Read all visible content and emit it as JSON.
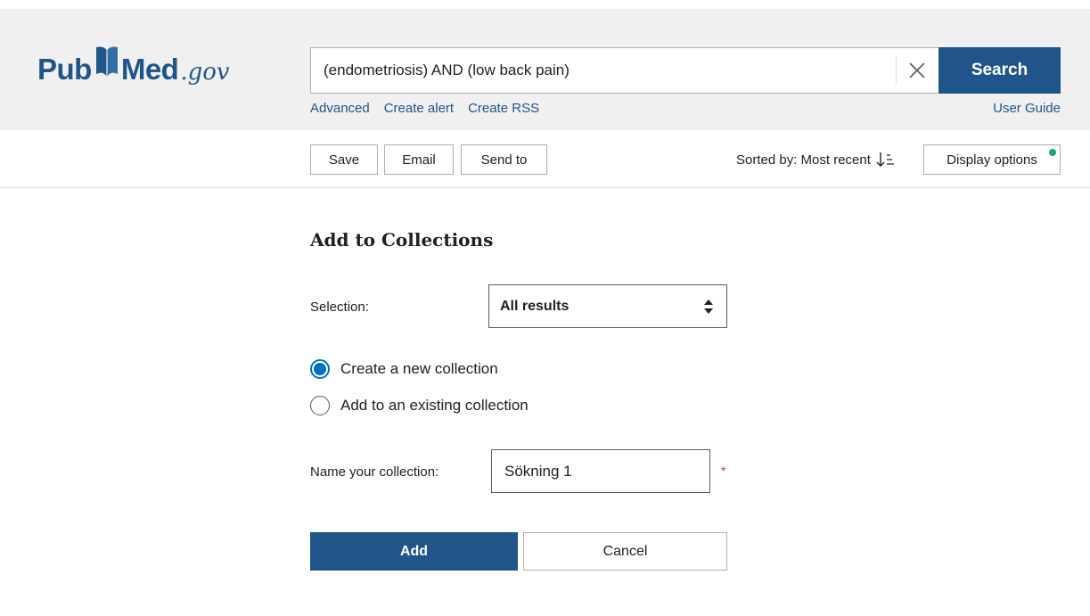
{
  "header": {
    "logo": {
      "part1": "Pub",
      "part2": "Med",
      "suffix": ".gov"
    },
    "search": {
      "query": "(endometriosis) AND (low back pain)",
      "button_label": "Search"
    },
    "links": {
      "advanced": "Advanced",
      "create_alert": "Create alert",
      "create_rss": "Create RSS",
      "user_guide": "User Guide"
    }
  },
  "toolbar": {
    "save_label": "Save",
    "email_label": "Email",
    "send_to_label": "Send to",
    "sorted_label": "Sorted by: Most recent",
    "display_options_label": "Display options"
  },
  "collections": {
    "title": "Add to Collections",
    "selection_label": "Selection:",
    "selection_value": "All results",
    "options": [
      {
        "label": "Create a new collection",
        "checked": true
      },
      {
        "label": "Add to an existing collection",
        "checked": false
      }
    ],
    "name_label": "Name your collection:",
    "name_value": "Sökning 1",
    "required_mark": "*",
    "add_label": "Add",
    "cancel_label": "Cancel"
  },
  "colors": {
    "brand": "#20558a",
    "radio_accent": "#0071bc",
    "notification_dot": "#1ba683",
    "required": "#d83933"
  }
}
